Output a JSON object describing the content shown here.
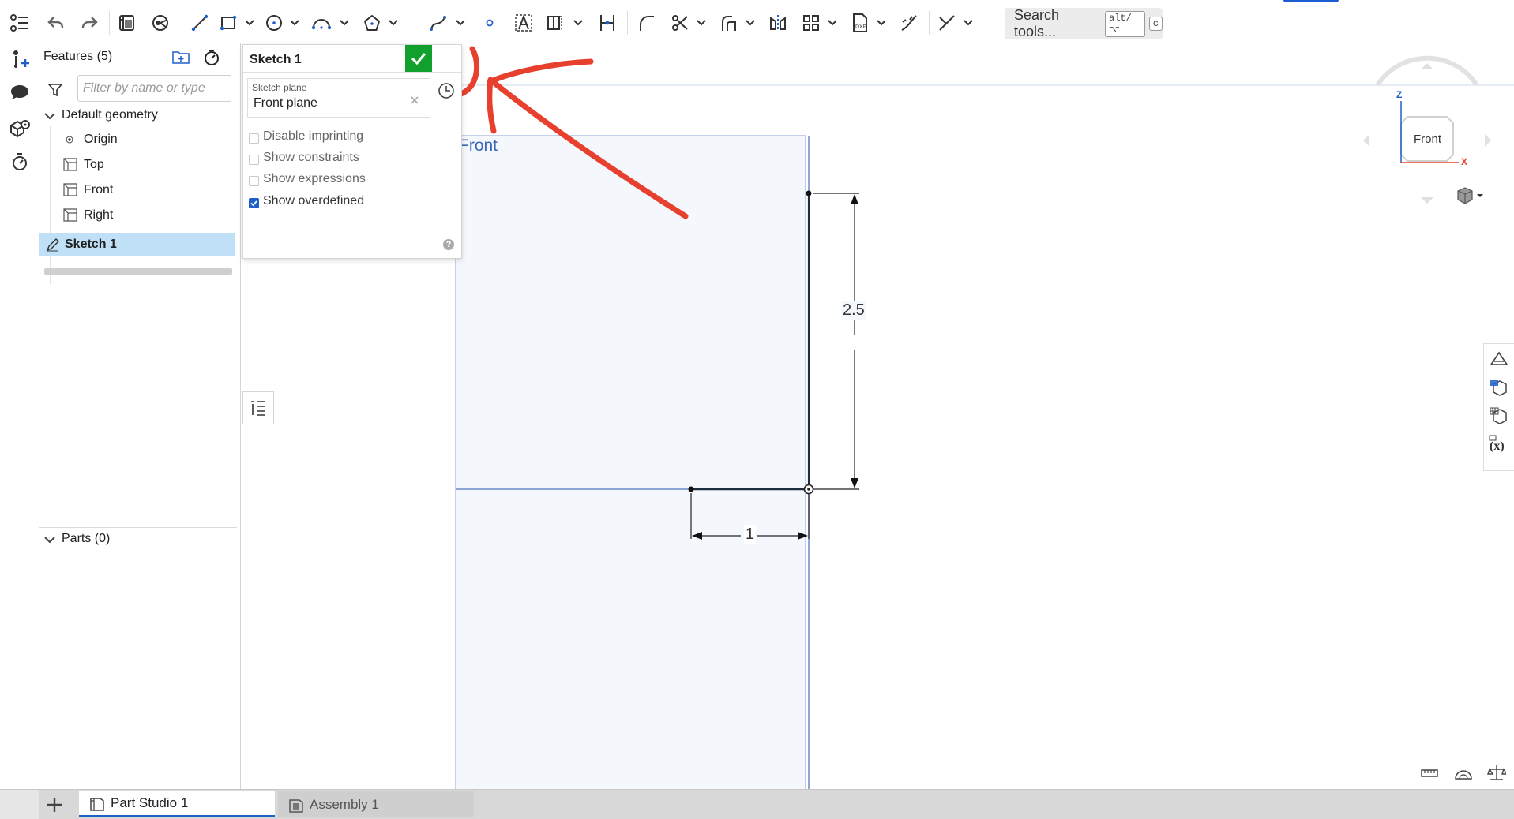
{
  "toolbar": {
    "search_label": "Search tools...",
    "search_shortcut_1": "alt/⌥",
    "search_shortcut_2": "c"
  },
  "features": {
    "title": "Features (5)",
    "filter_placeholder": "Filter by name or type",
    "default_geometry_label": "Default geometry",
    "items": [
      {
        "label": "Origin",
        "icon": "origin-icon"
      },
      {
        "label": "Top",
        "icon": "plane-icon"
      },
      {
        "label": "Front",
        "icon": "plane-icon"
      },
      {
        "label": "Right",
        "icon": "plane-icon"
      },
      {
        "label": "Sketch 1",
        "icon": "sketch-icon",
        "selected": true
      }
    ],
    "parts_label": "Parts (0)"
  },
  "sketch_dialog": {
    "title": "Sketch 1",
    "plane_label": "Sketch plane",
    "plane_value": "Front plane",
    "options": [
      {
        "label": "Disable imprinting",
        "checked": false
      },
      {
        "label": "Show constraints",
        "checked": false
      },
      {
        "label": "Show expressions",
        "checked": false
      },
      {
        "label": "Show overdefined",
        "checked": true
      }
    ]
  },
  "viewport": {
    "plane_name": "Front",
    "dimension_vertical": "2.5",
    "dimension_horizontal": "1",
    "view_cube_label": "Front",
    "axis_z": "Z",
    "axis_x": "X"
  },
  "tabs": [
    {
      "label": "Part Studio 1",
      "active": true
    },
    {
      "label": "Assembly 1",
      "active": false
    }
  ],
  "colors": {
    "accent": "#1f5fc8",
    "annotation": "#e8402f",
    "confirm": "#12a02c",
    "selected_row": "#bfe0f7",
    "sketch_plane_fill": "#f4f7fb",
    "sketch_plane_line": "#9fb6dd"
  }
}
